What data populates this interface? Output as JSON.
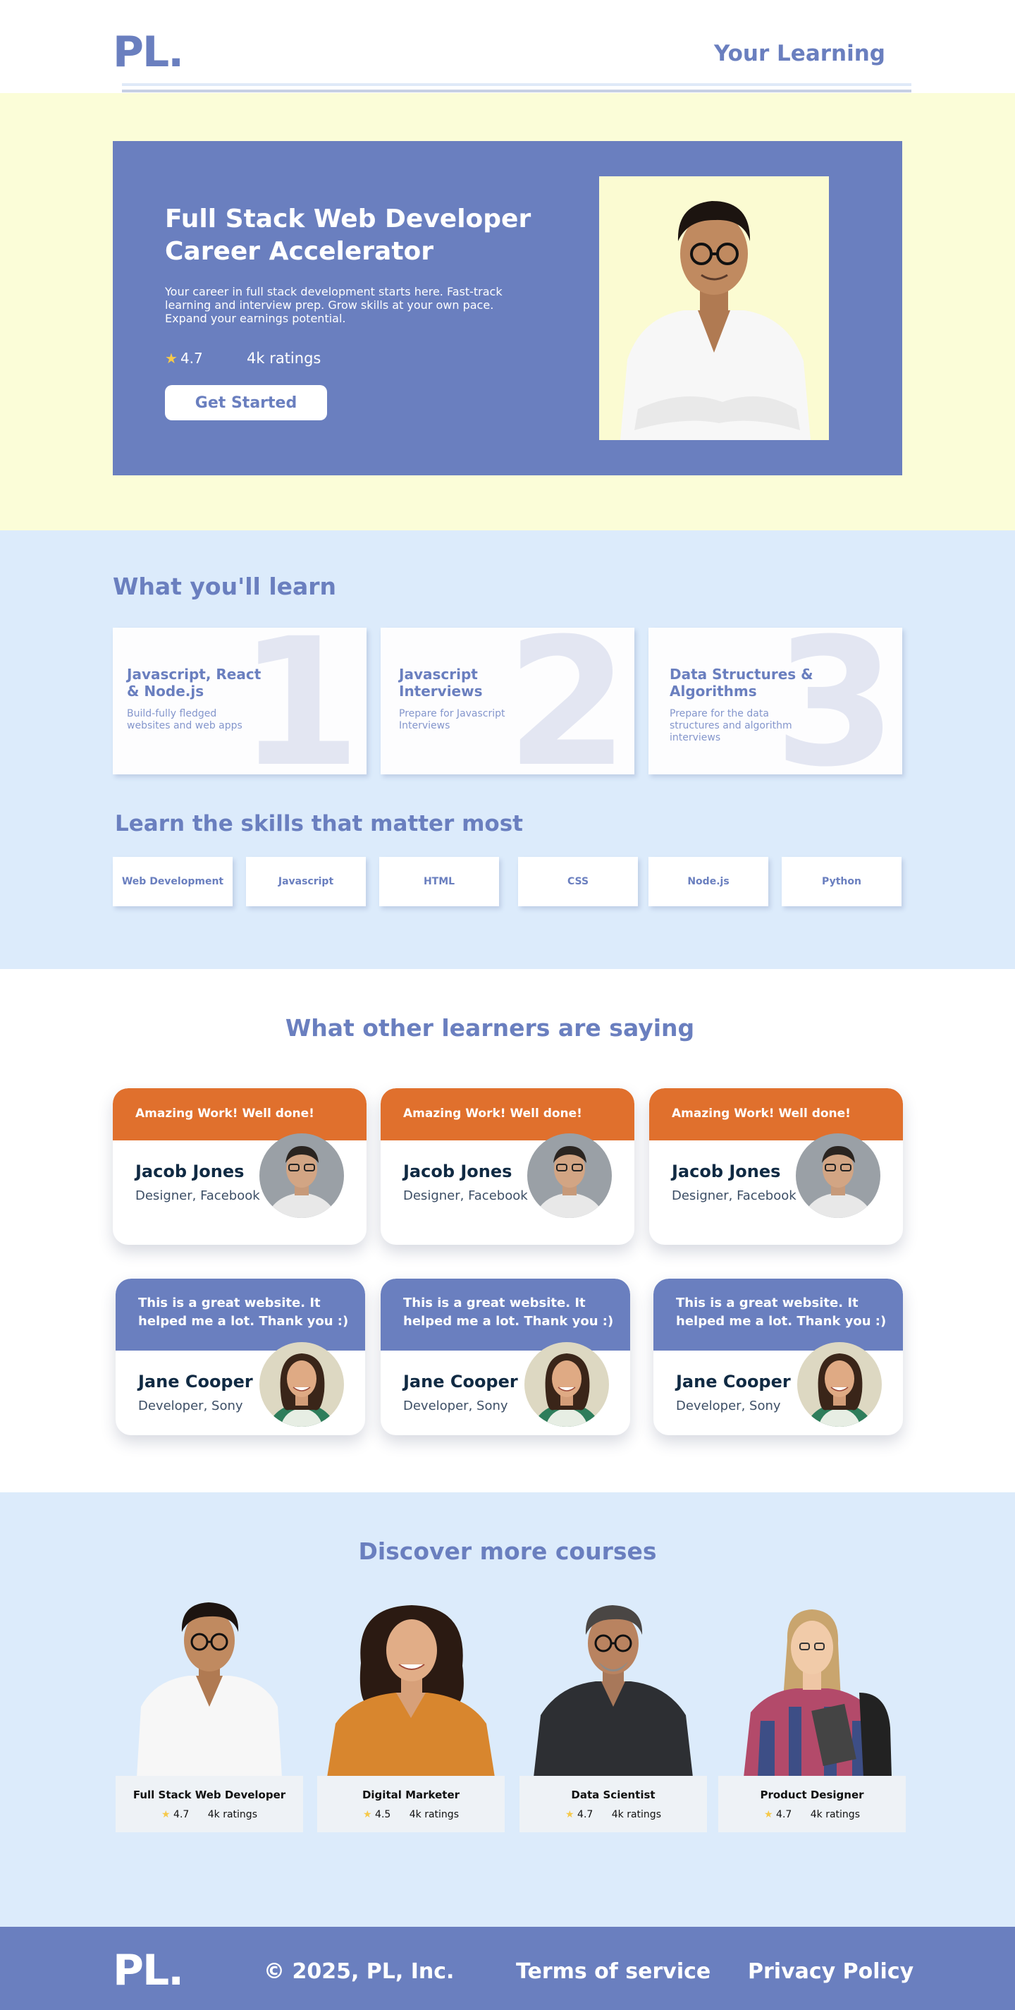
{
  "header": {
    "logo": "PL.",
    "nav_link": "Your Learning"
  },
  "hero": {
    "title": "Full Stack Web Developer Career Accelerator",
    "description": "Your career in full stack development starts here. Fast-track learning and interview prep. Grow skills at your own pace. Expand your earnings potential.",
    "rating": "4.7",
    "ratings_count": "4k ratings",
    "cta_label": "Get Started"
  },
  "learn": {
    "heading": "What you'll learn",
    "cards": [
      {
        "number": "1",
        "title": "Javascript, React & Node.js",
        "desc": "Build-fully fledged websites and web apps"
      },
      {
        "number": "2",
        "title": "Javascript Interviews",
        "desc": "Prepare for Javascript Interviews"
      },
      {
        "number": "3",
        "title": "Data Structures & Algorithms",
        "desc": "Prepare for the data structures and algorithm interviews"
      }
    ]
  },
  "skills": {
    "heading": "Learn the skills that matter most",
    "items": [
      "Web Development",
      "Javascript",
      "HTML",
      "CSS",
      "Node.js",
      "Python"
    ]
  },
  "testimonials": {
    "heading": "What other learners are saying",
    "row1": [
      {
        "quote": "Amazing Work! Well done!",
        "name": "Jacob Jones",
        "role": "Designer, Facebook"
      },
      {
        "quote": "Amazing Work! Well done!",
        "name": "Jacob Jones",
        "role": "Designer, Facebook"
      },
      {
        "quote": "Amazing Work! Well done!",
        "name": "Jacob Jones",
        "role": "Designer, Facebook"
      }
    ],
    "row2": [
      {
        "quote": "This is a great website. It helped me a lot. Thank you :)",
        "name": "Jane Cooper",
        "role": "Developer, Sony"
      },
      {
        "quote": "This is a great website. It helped me a lot. Thank you :)",
        "name": "Jane Cooper",
        "role": "Developer, Sony"
      },
      {
        "quote": "This is a great website. It helped me a lot. Thank you :)",
        "name": "Jane Cooper",
        "role": "Developer, Sony"
      }
    ]
  },
  "discover": {
    "heading": "Discover more courses",
    "courses": [
      {
        "title": "Full Stack Web Developer",
        "rating": "4.7",
        "ratings_count": "4k ratings"
      },
      {
        "title": "Digital Marketer",
        "rating": "4.5",
        "ratings_count": "4k ratings"
      },
      {
        "title": "Data Scientist",
        "rating": "4.7",
        "ratings_count": "4k ratings"
      },
      {
        "title": "Product Designer",
        "rating": "4.7",
        "ratings_count": "4k ratings"
      }
    ]
  },
  "footer": {
    "logo": "PL.",
    "copyright": "© 2025, PL, Inc.",
    "terms": "Terms of service",
    "privacy": "Privacy Policy"
  },
  "colors": {
    "brand": "#6a7fbf",
    "hero_band": "#fbfdd8",
    "section_band": "#dcebfb",
    "accent_orange": "#e0702d",
    "star": "#f6c94a"
  }
}
